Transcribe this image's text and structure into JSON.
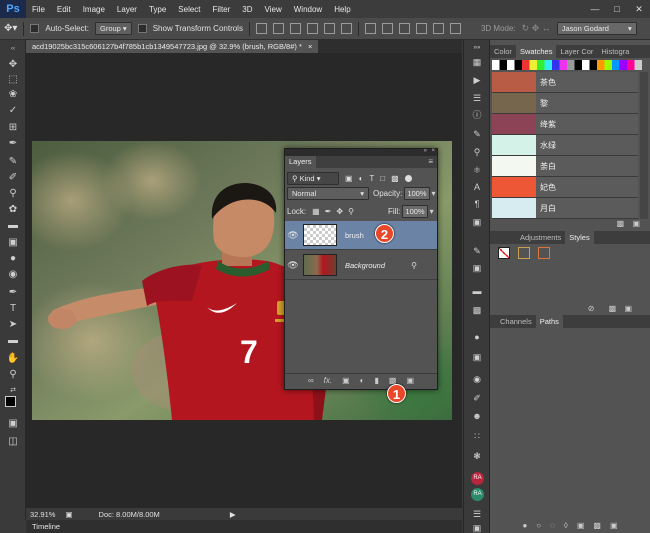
{
  "menubar": {
    "logo": "Ps",
    "items": [
      "File",
      "Edit",
      "Image",
      "Layer",
      "Type",
      "Select",
      "Filter",
      "3D",
      "View",
      "Window",
      "Help"
    ]
  },
  "options": {
    "auto_select_label": "Auto-Select:",
    "auto_select_value": "Group",
    "show_transform_label": "Show Transform Controls",
    "mode_label": "3D Mode:",
    "workspace": "Jason Godard"
  },
  "document": {
    "tab_title": "acd19025bc315c606127b4f785b1cb1349547723.jpg @ 32.9% (brush, RGB/8#) *",
    "jersey_number": "7"
  },
  "status": {
    "zoom": "32.91%",
    "doc": "Doc: 8.00M/8.00M",
    "timeline_label": "Timeline"
  },
  "layers_panel": {
    "tab": "Layers",
    "kind_label": "Kind",
    "blend_mode": "Normal",
    "opacity_label": "Opacity:",
    "opacity_value": "100%",
    "lock_label": "Lock:",
    "fill_label": "Fill:",
    "fill_value": "100%",
    "layers": [
      {
        "name": "brush",
        "selected": true
      },
      {
        "name": "Background",
        "selected": false
      }
    ],
    "callouts": [
      "2",
      "1"
    ]
  },
  "swatches_panel": {
    "tabs": [
      "Color",
      "Swatches",
      "Layer Cor",
      "Histogra"
    ],
    "active_tab": "Swatches",
    "swatches": [
      {
        "label": "茶色",
        "color": "#b85c45"
      },
      {
        "label": "黎",
        "color": "#75664d"
      },
      {
        "label": "绛紫",
        "color": "#8c4356"
      },
      {
        "label": "水绿",
        "color": "#d4f2e7"
      },
      {
        "label": "荼白",
        "color": "#f3f9f1"
      },
      {
        "label": "妃色",
        "color": "#ed5736"
      },
      {
        "label": "月白",
        "color": "#d6ecf0"
      }
    ]
  },
  "adjustments_panel": {
    "tabs": [
      "Adjustments",
      "Styles"
    ],
    "active_tab": "Styles"
  },
  "channels_panel": {
    "tabs": [
      "Channels",
      "Paths"
    ],
    "active_tab": "Paths"
  },
  "colors": {
    "accent_callout": "#e8472a",
    "selected_layer": "#6b84a6",
    "panel_bg": "#535353"
  }
}
